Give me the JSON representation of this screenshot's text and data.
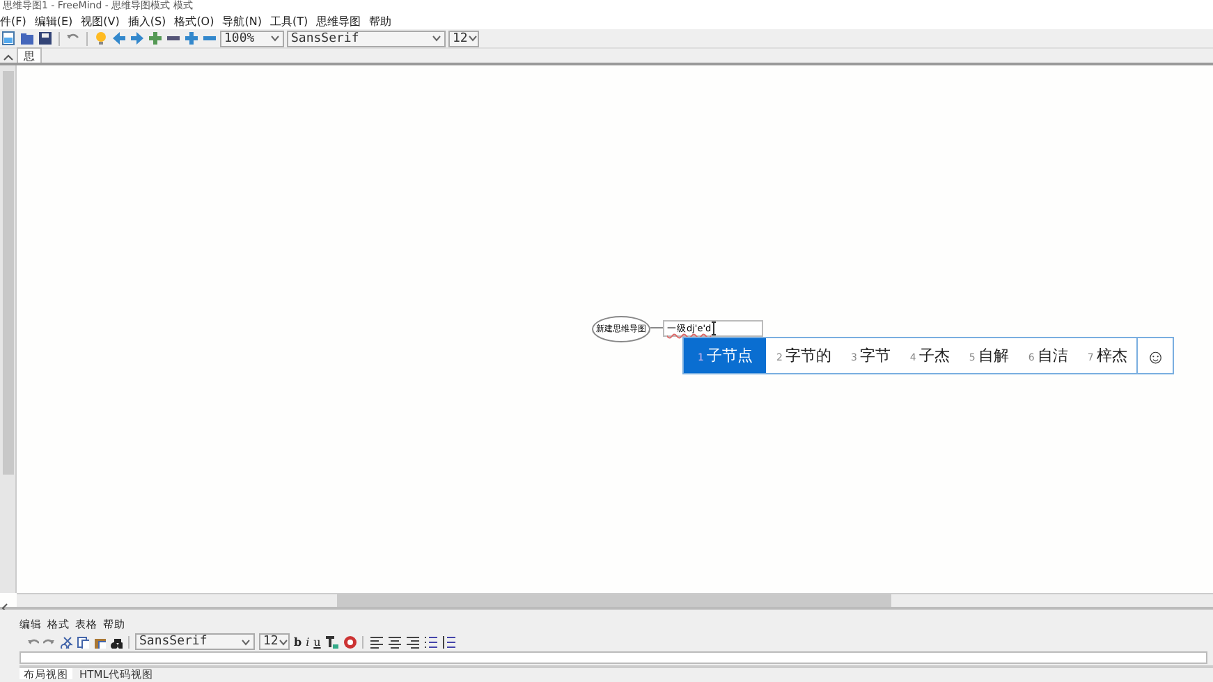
{
  "window": {
    "title": "思维导图1 - FreeMind - 思维导图模式 模式"
  },
  "menu": [
    "件(F)",
    "编辑(E)",
    "视图(V)",
    "插入(S)",
    "格式(O)",
    "导航(N)",
    "工具(T)",
    "思维导图",
    "帮助"
  ],
  "toolbar": {
    "zoom": "100%",
    "font": "SansSerif",
    "size": "12"
  },
  "tabs": [
    {
      "label": "思",
      "selected": true
    }
  ],
  "map": {
    "root": "新建思维导图",
    "editing_text": "一级dj'e'd"
  },
  "ime": {
    "candidates": [
      {
        "number": "1",
        "text": "子节点",
        "selected": true
      },
      {
        "number": "2",
        "text": "字节的",
        "selected": false
      },
      {
        "number": "3",
        "text": "字节",
        "selected": false
      },
      {
        "number": "4",
        "text": "子杰",
        "selected": false
      },
      {
        "number": "5",
        "text": "自解",
        "selected": false
      },
      {
        "number": "6",
        "text": "自洁",
        "selected": false
      },
      {
        "number": "7",
        "text": "梓杰",
        "selected": false
      }
    ],
    "emoji_button": "☺"
  },
  "editor": {
    "menu": [
      "编辑",
      "格式",
      "表格",
      "帮助"
    ],
    "font": "SansSerif",
    "size": "12",
    "format_buttons": [
      "b",
      "i",
      "u"
    ],
    "view_tabs": [
      {
        "label": "布局视图",
        "selected": true
      },
      {
        "label": "HTML代码视图",
        "selected": false
      }
    ]
  }
}
